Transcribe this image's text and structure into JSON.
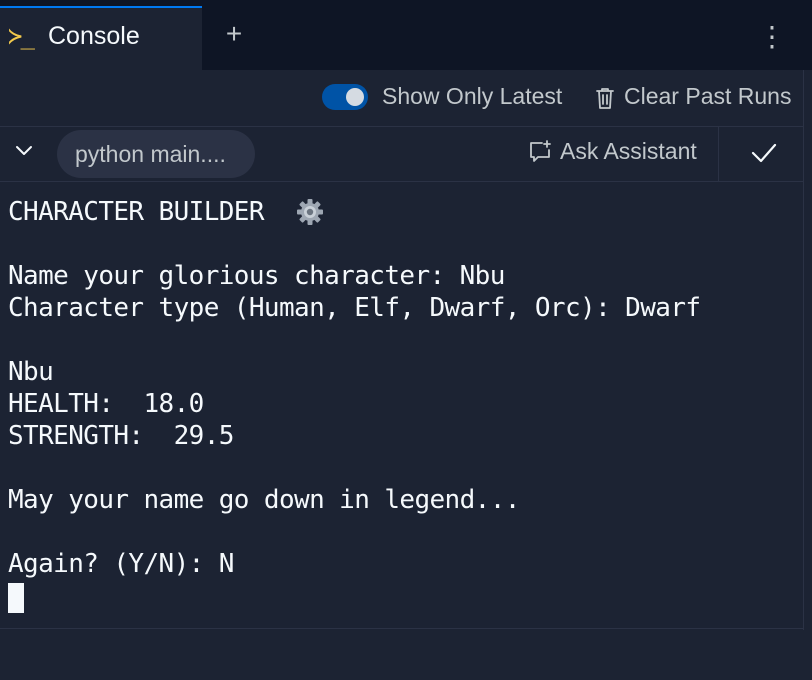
{
  "tabs": {
    "active": {
      "icon": "terminal-prompt-icon",
      "prompt_glyph": "≻_",
      "label": "Console"
    },
    "add_glyph": "+",
    "more_glyph": "⋮"
  },
  "toolbar": {
    "show_only_latest": {
      "label": "Show Only Latest",
      "enabled": true
    },
    "clear_past_runs": {
      "icon": "trash-icon",
      "label": "Clear Past Runs"
    }
  },
  "run": {
    "command": "python main....",
    "ask_assistant": {
      "icon": "chat-sparkle-icon",
      "label": "Ask Assistant"
    },
    "status_icon": "check-icon"
  },
  "console": {
    "lines": [
      "CHARACTER BUILDER",
      "Name your glorious character: Nbu",
      "Character type (Human, Elf, Dwarf, Orc): Dwarf",
      "Nbu",
      "HEALTH:  18.0",
      "STRENGTH:  29.5",
      "May your name go down in legend...",
      "Again? (Y/N): N"
    ],
    "title_emoji": "gear-icon"
  },
  "colors": {
    "background": "#1c2333",
    "tabbar": "#0e1525",
    "accent": "#0079f2",
    "toggle": "#0053a6",
    "text": "#f5f9fc",
    "muted": "#c2c8cc"
  }
}
